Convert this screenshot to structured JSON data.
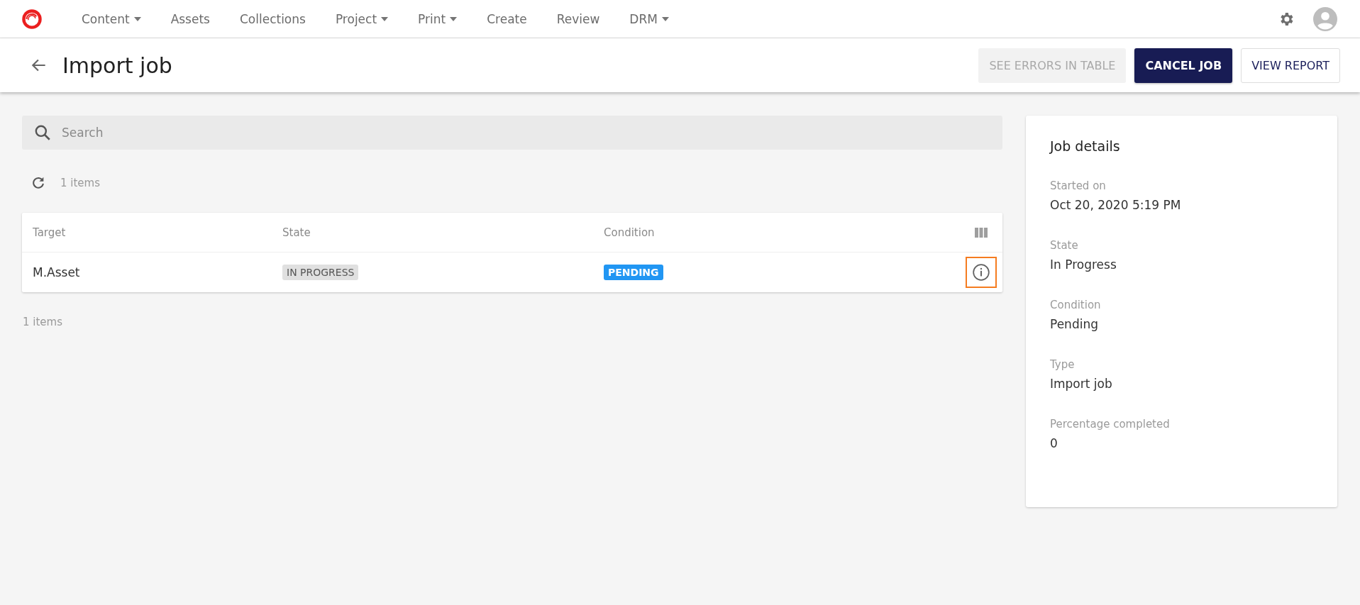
{
  "nav": {
    "items": [
      {
        "label": "Content",
        "dropdown": true
      },
      {
        "label": "Assets",
        "dropdown": false
      },
      {
        "label": "Collections",
        "dropdown": false
      },
      {
        "label": "Project",
        "dropdown": true
      },
      {
        "label": "Print",
        "dropdown": true
      },
      {
        "label": "Create",
        "dropdown": false
      },
      {
        "label": "Review",
        "dropdown": false
      },
      {
        "label": "DRM",
        "dropdown": true
      }
    ]
  },
  "header": {
    "title": "Import job",
    "buttons": [
      {
        "label": "SEE ERRORS IN TABLE",
        "kind": "flat",
        "disabled": true
      },
      {
        "label": "CANCEL JOB",
        "kind": "primary",
        "disabled": false
      },
      {
        "label": "VIEW REPORT",
        "kind": "outline",
        "disabled": false
      }
    ]
  },
  "search": {
    "placeholder": "Search"
  },
  "count_top": "1 items",
  "table": {
    "columns": [
      "Target",
      "State",
      "Condition"
    ],
    "rows": [
      {
        "target": "M.Asset",
        "state": {
          "text": "IN PROGRESS",
          "kind": "neutral"
        },
        "condition": {
          "text": "PENDING",
          "kind": "info"
        },
        "info_focused": true
      }
    ]
  },
  "count_bottom": "1 items",
  "details": {
    "title": "Job details",
    "fields": [
      {
        "label": "Started on",
        "value": "Oct 20, 2020 5:19 PM"
      },
      {
        "label": "State",
        "value": "In Progress"
      },
      {
        "label": "Condition",
        "value": "Pending"
      },
      {
        "label": "Type",
        "value": "Import job"
      },
      {
        "label": "Percentage completed",
        "value": "0"
      }
    ]
  }
}
